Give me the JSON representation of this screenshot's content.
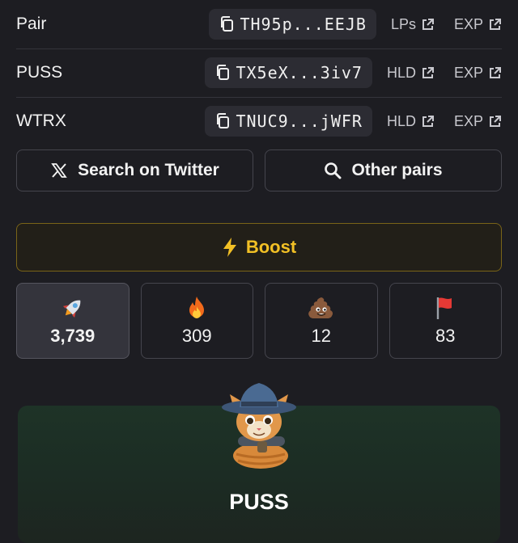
{
  "rows": [
    {
      "label": "Pair",
      "address": "TH95p...EEJB",
      "links": [
        "LPs",
        "EXP"
      ]
    },
    {
      "label": "PUSS",
      "address": "TX5eX...3iv7",
      "links": [
        "HLD",
        "EXP"
      ]
    },
    {
      "label": "WTRX",
      "address": "TNUC9...jWFR",
      "links": [
        "HLD",
        "EXP"
      ]
    }
  ],
  "actions": {
    "twitter": "Search on Twitter",
    "pairs": "Other pairs"
  },
  "boost": {
    "label": "Boost",
    "color": "#f2c025"
  },
  "reactions": [
    {
      "icon": "rocket-icon",
      "count": "3,739",
      "active": true
    },
    {
      "icon": "fire-icon",
      "count": "309"
    },
    {
      "icon": "poop-icon",
      "count": "12"
    },
    {
      "icon": "red-flag-icon",
      "count": "83"
    }
  ],
  "token": {
    "name": "PUSS"
  }
}
